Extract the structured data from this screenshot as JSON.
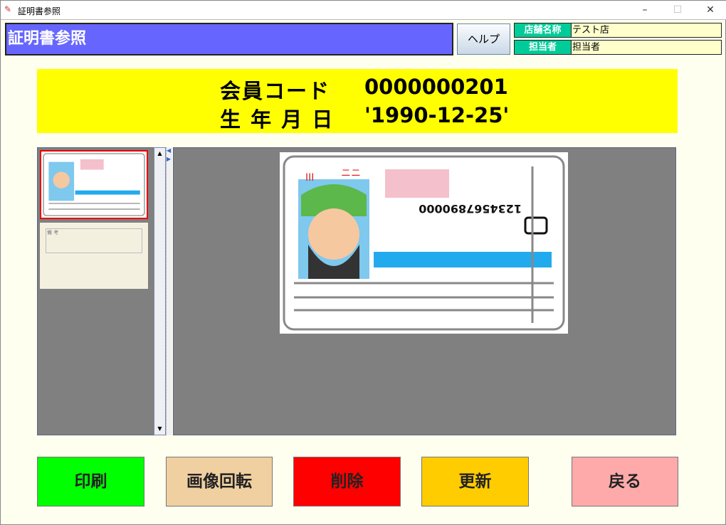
{
  "window": {
    "title": "証明書参照",
    "minimize": "–",
    "maximize": "☐",
    "close": "✕"
  },
  "header": {
    "title": "証明書参照",
    "help_label": "ヘルプ",
    "store_label": "店舗名称",
    "store_value": "テスト店",
    "staff_label": "担当者",
    "staff_value": "担当者"
  },
  "banner": {
    "member_label": "会員コード",
    "member_code": "0000000201",
    "birth_label": "生 年 月 日",
    "birth_value": "'1990-12-25'"
  },
  "thumbnails": [
    {
      "name": "card-front",
      "selected": true
    },
    {
      "name": "card-back",
      "selected": false
    }
  ],
  "thumb_back_label": "備 考",
  "buttons": {
    "print": "印刷",
    "rotate": "画像回転",
    "delete": "削除",
    "update": "更新",
    "back": "戻る"
  },
  "colors": {
    "header": "#6666ff",
    "label": "#00cc99",
    "banner": "#ffff00",
    "print": "#00ff00",
    "rotate": "#f0d0a0",
    "delete": "#ff0000",
    "update": "#ffcc00",
    "back": "#ffaaaa"
  }
}
